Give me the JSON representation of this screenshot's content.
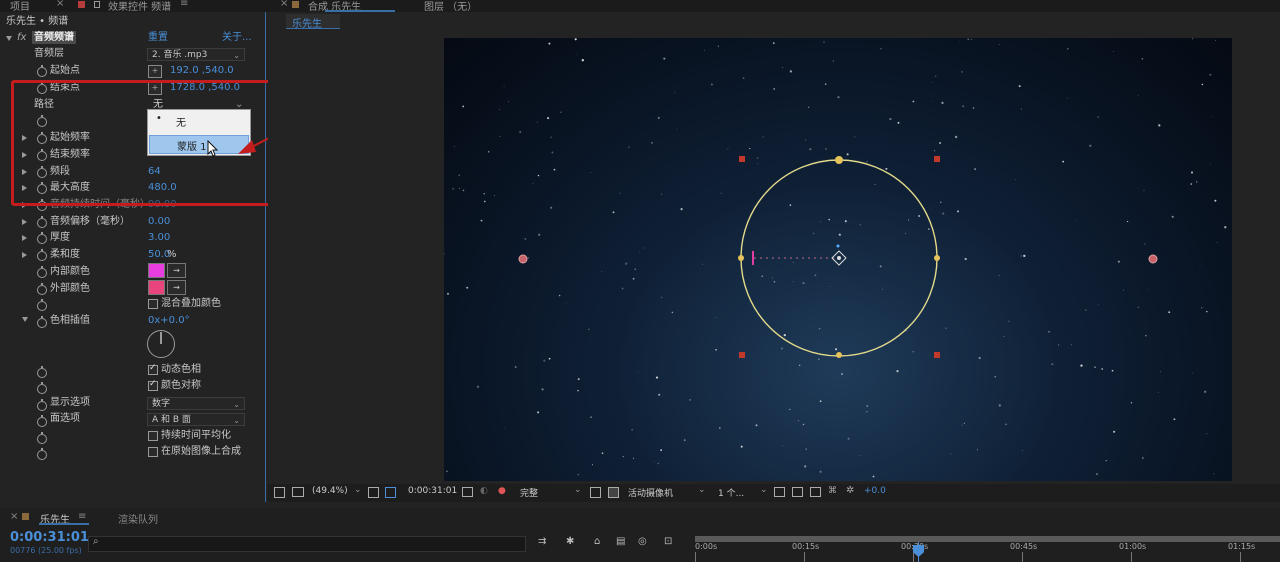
{
  "top_tabs": {
    "project": "项目",
    "effects_controls": "效果控件 频谱",
    "composition": "合成 乐先生",
    "layer": "图层 （无）"
  },
  "comp_tab": "乐先生",
  "effect_panel": {
    "breadcrumb": "乐先生 • 频谱",
    "fx_label": "fx",
    "effect_name": "音频频谱",
    "reset": "重置",
    "about": "关于...",
    "audio_layer_label": "音频层",
    "audio_layer_value": "2. 音乐 .mp3",
    "start_point_label": "起始点",
    "start_point_value": "192.0 ,540.0",
    "end_point_label": "结束点",
    "end_point_value": "1728.0 ,540.0",
    "path_label": "路径",
    "path_value": "无",
    "start_freq_label": "起始频率",
    "end_freq_label": "结束频率",
    "bands_label": "频段",
    "bands_value": "64",
    "max_height_label": "最大高度",
    "max_height_value": "480.0",
    "audio_duration_label": "音频持续时间（毫秒）",
    "audio_duration_value": "90.00",
    "audio_offset_label": "音频偏移（毫秒）",
    "audio_offset_value": "0.00",
    "thickness_label": "厚度",
    "thickness_value": "3.00",
    "softness_label": "柔和度",
    "softness_value": "50.0",
    "softness_unit": "%",
    "inside_color_label": "内部颜色",
    "inside_color": "#e83ee0",
    "outside_color_label": "外部颜色",
    "outside_color": "#e8457e",
    "blend_label": "混合叠加颜色",
    "hue_label": "色相插值",
    "hue_value": "0x+0.0°",
    "dynamic_hue_label": "动态色相",
    "color_sym_label": "颜色对称",
    "display_label": "显示选项",
    "display_value": "数字",
    "side_label": "面选项",
    "side_value": "A 和 B 面",
    "avg_label": "持续时间平均化",
    "composite_label": "在原始图像上合成"
  },
  "popup": {
    "option_none": "无",
    "option_mask": "蒙版 1"
  },
  "viewer_toolbar": {
    "zoom": "(49.4%)",
    "timecode": "0:00:31:01",
    "quality": "完整",
    "camera": "活动摄像机",
    "views": "1 个...",
    "exposure": "+0.0"
  },
  "timeline": {
    "tab": "乐先生",
    "render_queue": "渲染队列",
    "timecode": "0:00:31:01",
    "frame_info": "00776 (25.00 fps)",
    "ruler": [
      "0:00s",
      "00:15s",
      "00:30s",
      "00:45s",
      "01:00s",
      "01:15s"
    ]
  },
  "colors": {
    "accent_blue": "#4a8fd8",
    "highlight_red": "#c41d1d",
    "circle_yellow": "#e2d98a"
  }
}
